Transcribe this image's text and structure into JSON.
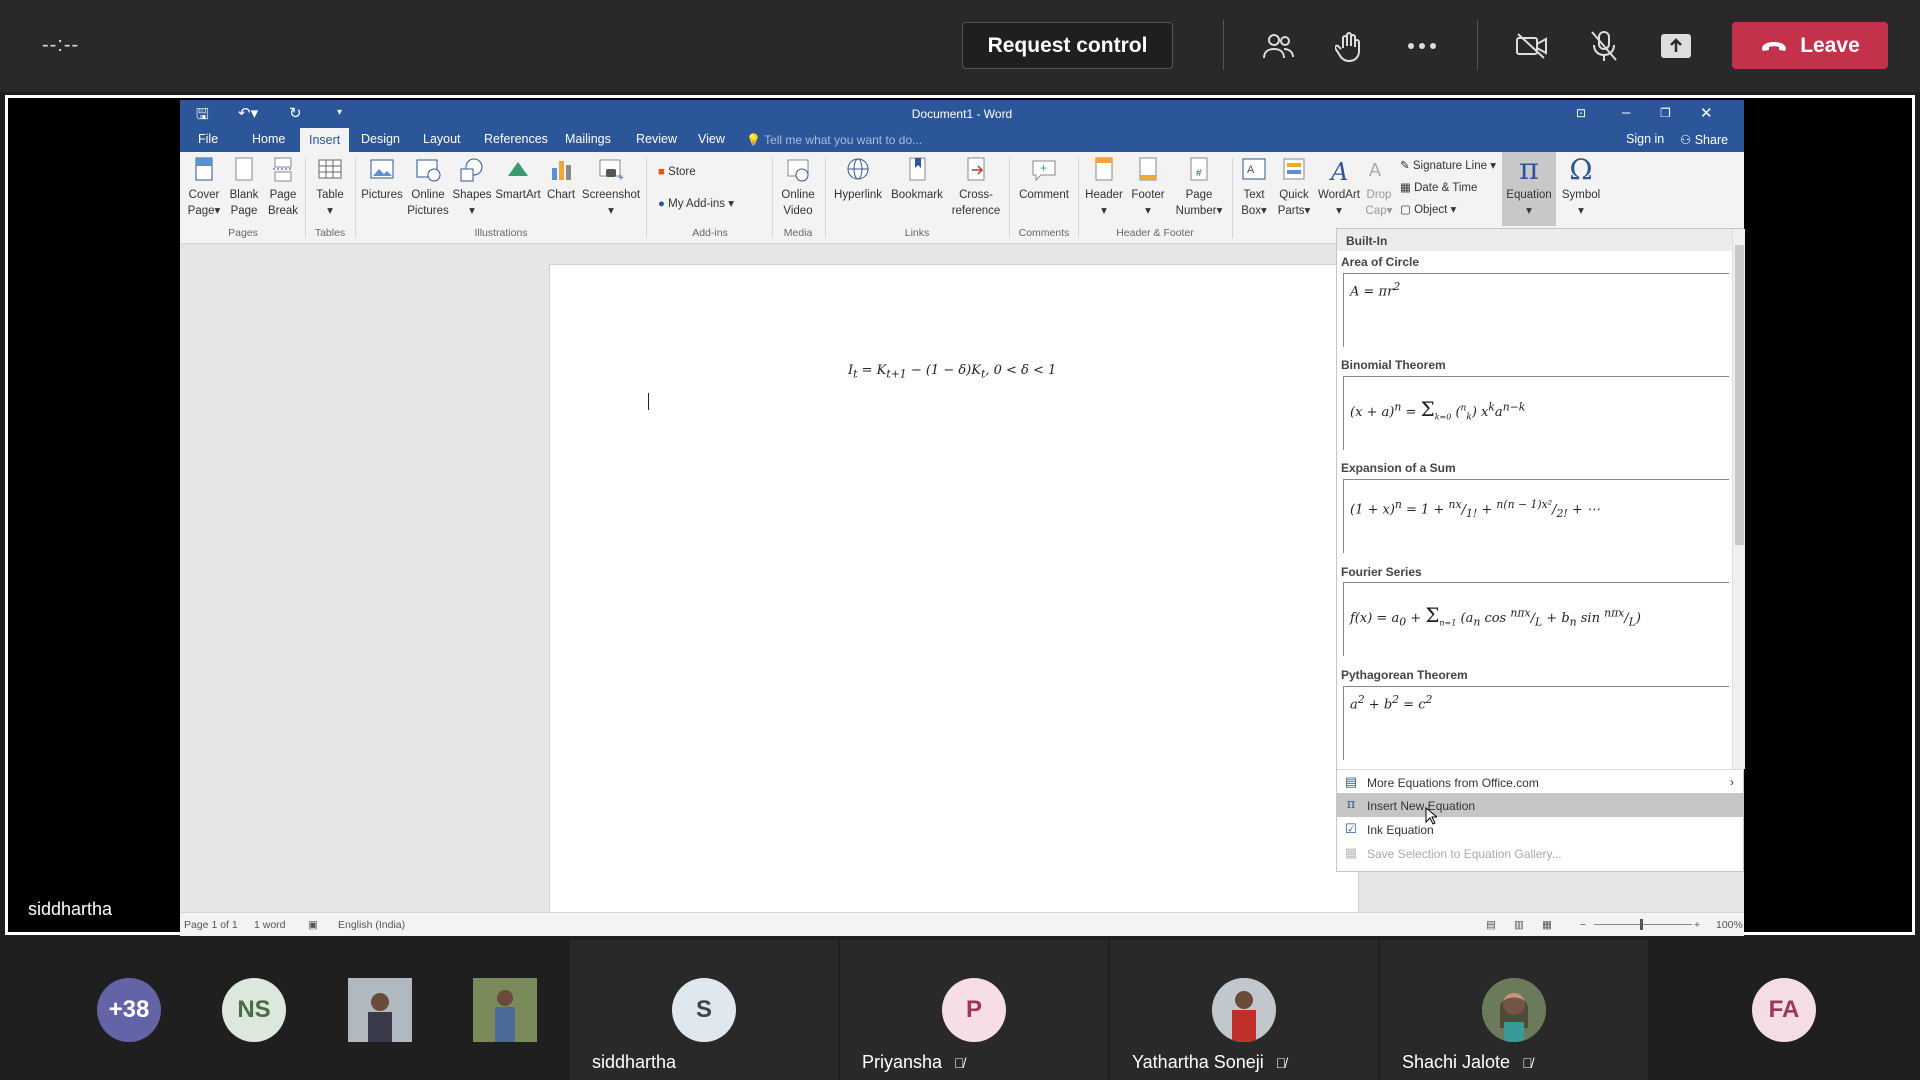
{
  "meeting": {
    "timer": "--:--",
    "request_control": "Request control",
    "leave": "Leave",
    "presenter": "siddhartha"
  },
  "word": {
    "title": "Document1 - Word",
    "tabs": [
      "File",
      "Home",
      "Insert",
      "Design",
      "Layout",
      "References",
      "Mailings",
      "Review",
      "View"
    ],
    "active_tab": "Insert",
    "tell_me": "Tell me what you want to do...",
    "sign_in": "Sign in",
    "share": "Share",
    "ribbon": {
      "cover_page": [
        "Cover",
        "Page"
      ],
      "blank_page": [
        "Blank",
        "Page"
      ],
      "page_break": [
        "Page",
        "Break"
      ],
      "table": "Table",
      "pictures": "Pictures",
      "online_pictures": [
        "Online",
        "Pictures"
      ],
      "shapes": "Shapes",
      "smartart": "SmartArt",
      "chart": "Chart",
      "screenshot": "Screenshot",
      "store": "Store",
      "my_addins": "My Add-ins",
      "online_video": [
        "Online",
        "Video"
      ],
      "hyperlink": "Hyperlink",
      "bookmark": "Bookmark",
      "cross_reference": [
        "Cross-",
        "reference"
      ],
      "comment": "Comment",
      "header": "Header",
      "footer": "Footer",
      "page_number": [
        "Page",
        "Number"
      ],
      "text_box": [
        "Text",
        "Box"
      ],
      "quick_parts": [
        "Quick",
        "Parts"
      ],
      "wordart": "WordArt",
      "drop_cap": [
        "Drop",
        "Cap"
      ],
      "signature_line": "Signature Line",
      "date_time": "Date & Time",
      "object": "Object",
      "equation": "Equation",
      "symbol": "Symbol",
      "groups": [
        "Pages",
        "Tables",
        "Illustrations",
        "Add-ins",
        "Media",
        "Links",
        "Comments",
        "Header & Footer"
      ]
    },
    "document_equation": "I_t = K_{t+1} − (1 − δ)K_t, 0 < δ < 1",
    "status": {
      "page": "Page 1 of 1",
      "words": "1 word",
      "language": "English (India)",
      "zoom": "100%"
    },
    "gallery": {
      "header": "Built-In",
      "items": [
        {
          "title": "Area of Circle",
          "equation": "A = πr²"
        },
        {
          "title": "Binomial Theorem",
          "equation": "(x + a)ⁿ = Σₖ₌₀ⁿ (ⁿₖ) xᵏaⁿ⁻ᵏ"
        },
        {
          "title": "Expansion of a Sum",
          "equation": "(1 + x)ⁿ = 1 + nx/1! + n(n − 1)x²/2! + ⋯"
        },
        {
          "title": "Fourier Series",
          "equation": "f(x) = a₀ + Σₙ₌₁^∞ (aₙ cos nπx/L + bₙ sin nπx/L)"
        },
        {
          "title": "Pythagorean Theorem",
          "equation": "a² + b² = c²"
        }
      ],
      "menu": [
        {
          "label": "More Equations from Office.com",
          "state": "normal"
        },
        {
          "label": "Insert New Equation",
          "state": "highlight"
        },
        {
          "label": "Ink Equation",
          "state": "normal"
        },
        {
          "label": "Save Selection to Equation Gallery...",
          "state": "disabled"
        }
      ]
    }
  },
  "participants": [
    {
      "initials": "+38",
      "color": "#6264a7",
      "text_color": "#ffffff"
    },
    {
      "initials": "NS",
      "color": "#dce8dc",
      "text_color": "#4b6b4b"
    },
    {
      "initials": "",
      "color": "#7a8a9a",
      "text_color": "#ffffff",
      "photo": true
    },
    {
      "initials": "",
      "color": "#6a7a4a",
      "text_color": "#ffffff",
      "photo": true
    },
    {
      "initials": "S",
      "color": "#dfe8ee",
      "text_color": "#444444",
      "name": "siddhartha",
      "muted": false
    },
    {
      "initials": "P",
      "color": "#f6dde6",
      "text_color": "#a0345a",
      "name": "Priyansha",
      "muted": true
    },
    {
      "initials": "",
      "color": "#9aa6ae",
      "text_color": "#ffffff",
      "name": "Yathartha Soneji",
      "muted": true,
      "photo": true
    },
    {
      "initials": "",
      "color": "#8a6a5a",
      "text_color": "#ffffff",
      "name": "Shachi Jalote",
      "muted": true,
      "photo": true
    },
    {
      "initials": "FA",
      "color": "#f5dde6",
      "text_color": "#a0345a"
    }
  ]
}
